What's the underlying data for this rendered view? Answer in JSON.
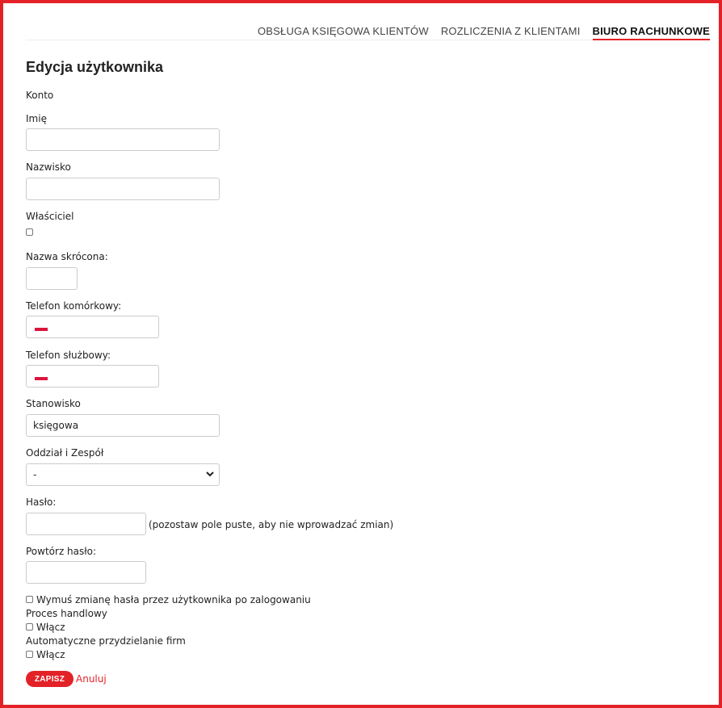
{
  "nav": {
    "tabs": [
      {
        "label": "OBSŁUGA KSIĘGOWA KLIENTÓW"
      },
      {
        "label": "ROZLICZENIA Z KLIENTAMI"
      },
      {
        "label": "BIURO RACHUNKOWE",
        "active": true
      }
    ]
  },
  "page": {
    "title": "Edycja użytkownika"
  },
  "form": {
    "section_label": "Konto",
    "first_name": {
      "label": "Imię",
      "value": ""
    },
    "last_name": {
      "label": "Nazwisko",
      "value": ""
    },
    "owner": {
      "label": "Właściciel",
      "checked": false
    },
    "short_name": {
      "label": "Nazwa skrócona:",
      "value": ""
    },
    "mobile_phone": {
      "label": "Telefon komórkowy:",
      "value": "",
      "flag_icon": "poland-flag-icon"
    },
    "work_phone": {
      "label": "Telefon służbowy:",
      "value": "",
      "flag_icon": "poland-flag-icon"
    },
    "position": {
      "label": "Stanowisko",
      "value": "księgowa"
    },
    "department": {
      "label": "Oddział i Zespół",
      "selected": "-",
      "icon": "chevron-down-icon"
    },
    "password": {
      "label": "Hasło:",
      "value": "",
      "hint": "(pozostaw pole puste, aby nie wprowadzać zmian)"
    },
    "repeat_password": {
      "label": "Powtórz hasło:",
      "value": ""
    },
    "force_change": {
      "label": "Wymuś zmianę hasła przez użytkownika po zalogowaniu",
      "checked": false
    },
    "sales_process": {
      "label": "Proces handlowy",
      "option_label": "Włącz",
      "checked": false
    },
    "auto_assign": {
      "label": "Automatyczne przydzielanie firm",
      "option_label": "Włącz",
      "checked": false
    }
  },
  "actions": {
    "save_label": "ZAPISZ",
    "cancel_label": "Anuluj"
  },
  "colors": {
    "accent": "#e32228",
    "border": "#cccccc",
    "flag_red": "#dc143c"
  }
}
